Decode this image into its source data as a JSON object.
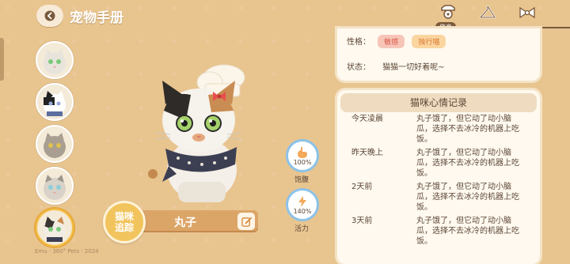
{
  "header": {
    "title": "宠物手册",
    "tab_badge": "信息"
  },
  "pets": [
    {
      "name": "pet-1"
    },
    {
      "name": "pet-2"
    },
    {
      "name": "pet-3"
    },
    {
      "name": "pet-4"
    },
    {
      "name": "pet-5"
    }
  ],
  "cat": {
    "name": "丸子",
    "track_label": "猫咪追踪"
  },
  "meters": [
    {
      "value": "100%",
      "label": "饱腹",
      "icon": "stomach-icon",
      "level": 1.0
    },
    {
      "value": "140%",
      "label": "活力",
      "icon": "lightning-icon",
      "level": 1.4
    }
  ],
  "info": {
    "personality_label": "性格：",
    "tags": [
      "敏感",
      "独行喵"
    ],
    "status_label": "状态：",
    "status_text": "猫猫一切好着呢~"
  },
  "mood": {
    "title": "猫咪心情记录",
    "records": [
      {
        "time": "今天凌晨",
        "text": "丸子饿了，但它动了动小脑瓜，选择不去冰冷的机器上吃饭。"
      },
      {
        "time": "昨天晚上",
        "text": "丸子饿了，但它动了动小脑瓜，选择不去冰冷的机器上吃饭。"
      },
      {
        "time": "2天前",
        "text": "丸子饿了，但它动了动小脑瓜，选择不去冰冷的机器上吃饭。"
      },
      {
        "time": "3天前",
        "text": "丸子饿了，但它动了动小脑瓜，选择不去冰冷的机器上吃饭。"
      }
    ]
  },
  "footer": {
    "watermark": "Emu · 360° Pets · 2024"
  },
  "colors": {
    "background": "#e8c48f",
    "accent": "#f2c45e",
    "meter_ring": "#8cc2e8"
  }
}
